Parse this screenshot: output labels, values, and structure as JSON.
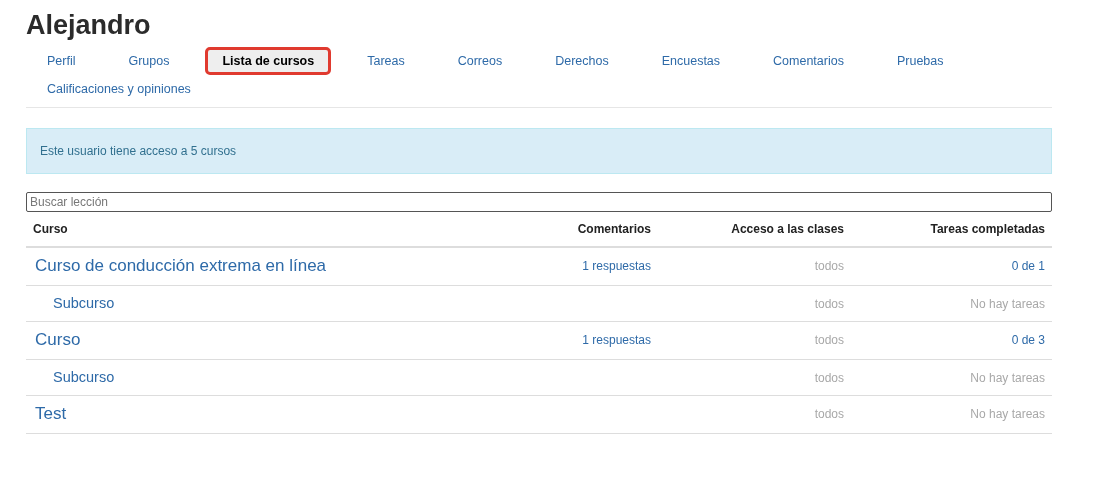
{
  "title": "Alejandro",
  "tabs": [
    {
      "label": "Perfil",
      "selected": false
    },
    {
      "label": "Grupos",
      "selected": false
    },
    {
      "label": "Lista de cursos",
      "selected": true
    },
    {
      "label": "Tareas",
      "selected": false
    },
    {
      "label": "Correos",
      "selected": false
    },
    {
      "label": "Derechos",
      "selected": false
    },
    {
      "label": "Encuestas",
      "selected": false
    },
    {
      "label": "Comentarios",
      "selected": false
    },
    {
      "label": "Pruebas",
      "selected": false
    },
    {
      "label": "Calificaciones y opiniones",
      "selected": false
    }
  ],
  "info": "Este usuario tiene acceso a 5 cursos",
  "search": {
    "placeholder": "Buscar lección"
  },
  "table": {
    "columns": [
      "Curso",
      "Comentarios",
      "Acceso a las clases",
      "Tareas completadas"
    ],
    "rows": [
      {
        "name": "Curso de conducción extrema en línea",
        "comments": "1 respuestas",
        "access": "todos",
        "tasks": {
          "text": "0 de 1",
          "kind": "count"
        },
        "children": [
          {
            "name": "Subcurso",
            "access": "todos",
            "tasks": {
              "text": "No hay tareas",
              "kind": "none"
            }
          }
        ]
      },
      {
        "name": "Curso",
        "comments": "1 respuestas",
        "access": "todos",
        "tasks": {
          "text": "0 de 3",
          "kind": "count"
        },
        "children": [
          {
            "name": "Subcurso",
            "access": "todos",
            "tasks": {
              "text": "No hay tareas",
              "kind": "none"
            }
          }
        ]
      },
      {
        "name": "Test",
        "access": "todos",
        "tasks": {
          "text": "No hay tareas",
          "kind": "none"
        }
      }
    ]
  }
}
